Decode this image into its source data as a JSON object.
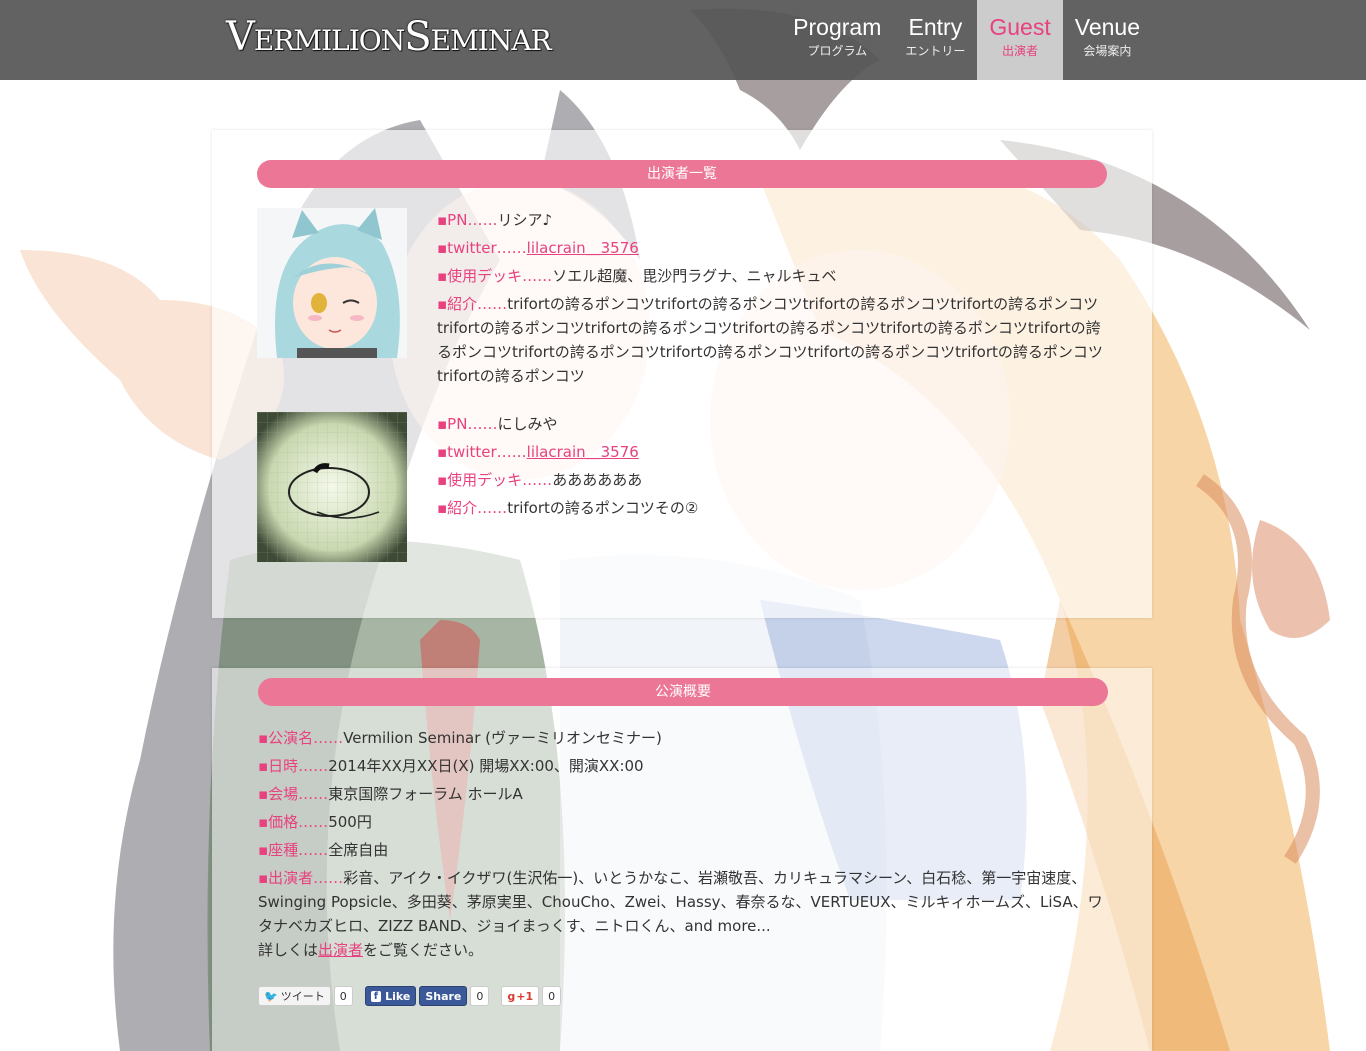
{
  "header": {
    "logo_big_v": "V",
    "logo_part1": "ERMILION",
    "logo_big_s": "S",
    "logo_part2": "EMINAR",
    "nav": [
      {
        "en": "Program",
        "ja": "プログラム"
      },
      {
        "en": "Entry",
        "ja": "エントリー"
      },
      {
        "en": "Guest",
        "ja": "出演者"
      },
      {
        "en": "Venue",
        "ja": "会場案内"
      }
    ]
  },
  "guests_section": {
    "title": "出演者一覧",
    "guests": [
      {
        "pn_label": "PN……",
        "pn": "リシア♪",
        "twitter_label": "twitter……",
        "twitter": "lilacrain＿3576",
        "deck_label": "使用デッキ……",
        "deck": "ソエル超魔、毘沙門ラグナ、ニャルキュベ",
        "intro_label": "紹介……",
        "intro": "trifortの誇るポンコツtrifortの誇るポンコツtrifortの誇るポンコツtrifortの誇るポンコツtrifortの誇るポンコツtrifortの誇るポンコツtrifortの誇るポンコツtrifortの誇るポンコツtrifortの誇るポンコツtrifortの誇るポンコツtrifortの誇るポンコツtrifortの誇るポンコツtrifortの誇るポンコツtrifortの誇るポンコツ"
      },
      {
        "pn_label": "PN……",
        "pn": "にしみや",
        "twitter_label": "twitter……",
        "twitter": "lilacrain＿3576",
        "deck_label": "使用デッキ……",
        "deck": "ああああああ",
        "intro_label": "紹介……",
        "intro": "trifortの誇るポンコツその②"
      }
    ]
  },
  "overview": {
    "title": "公演概要",
    "name_label": "公演名……",
    "name": "Vermilion Seminar (ヴァーミリオンセミナー)",
    "date_label": "日時……",
    "date": "2014年XX月XX日(X) 開場XX:00、開演XX:00",
    "venue_label": "会場……",
    "venue": "東京国際フォーラム ホールA",
    "price_label": "価格……",
    "price": "500円",
    "seat_label": "座種……",
    "seat": "全席自由",
    "performers_label": "出演者……",
    "performers": "彩音、アイク・イクザワ(生沢佑一)、いとうかなこ、岩瀬敬吾、カリキュラマシーン、白石稔、第一宇宙速度、Swinging Popsicle、多田葵、茅原実里、ChouCho、Zwei、Hassy、春奈るな、VERTUEUX、ミルキィホームズ、LiSA、ワタナベカズヒロ、ZIZZ BAND、ジョイまっくす、ニトロくん、and more...",
    "details_prefix": "詳しくは",
    "details_link": "出演者",
    "details_suffix": "をご覧ください。"
  },
  "social": {
    "tweet_label": "ツイート",
    "tweet_count": "0",
    "like_label": "Like",
    "share_label": "Share",
    "fb_count": "0",
    "gplus_label": "+1",
    "gplus_count": "0"
  },
  "colors": {
    "accent": "#e8417f",
    "section_bar": "#ec7696",
    "header_bg": "#555555",
    "fb_blue": "#3b5998"
  }
}
